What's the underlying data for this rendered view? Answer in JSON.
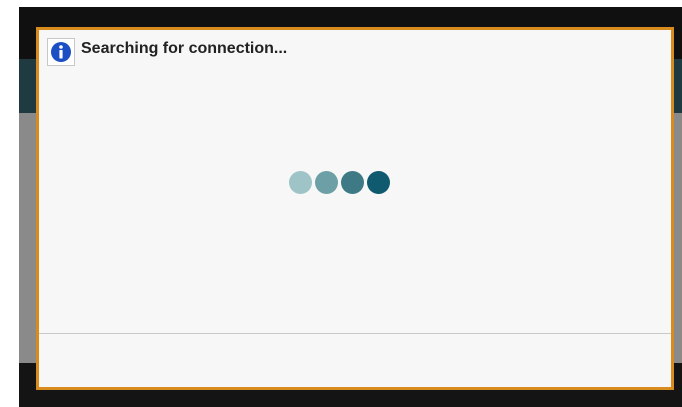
{
  "dialog": {
    "title": "Searching for connection...",
    "icon": "info-icon",
    "border_color": "#d98c1e",
    "background_color": "#f7f7f7"
  },
  "spinner": {
    "dot_colors": [
      "#9fc4c7",
      "#6d9fa6",
      "#3e7a86",
      "#0f5a6e"
    ]
  },
  "background": {
    "teal_bar_color": "#1f3a40",
    "content_color": "#8a8a8a"
  }
}
